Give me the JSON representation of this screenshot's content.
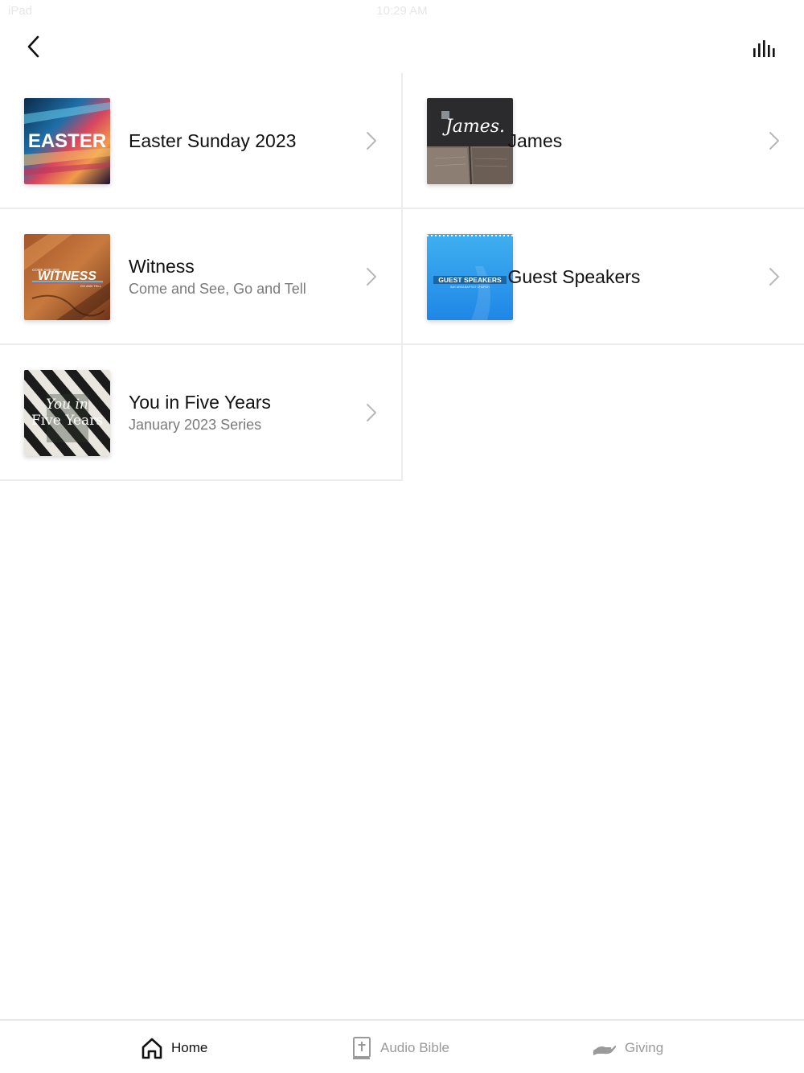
{
  "status_bar": {
    "carrier": "iPad",
    "time": "10:29 AM"
  },
  "nav": {
    "back_icon": "chevron-left-icon",
    "audio_icon": "audio-bars-icon"
  },
  "series": [
    {
      "title": "Easter Sunday 2023",
      "subtitle": "",
      "art_text": "EASTER"
    },
    {
      "title": "James",
      "subtitle": "",
      "art_text": "James."
    },
    {
      "title": "Witness",
      "subtitle": "Come and See, Go and Tell",
      "art_text": "WITNESS",
      "art_small_top": "COME AND SEE",
      "art_small_bottom": "GO AND TELL"
    },
    {
      "title": "Guest Speakers",
      "subtitle": "",
      "art_text": "GUEST SPEAKERS",
      "art_small": "BAY AREA BAPTIST CHURCH"
    },
    {
      "title": "You in Five Years",
      "subtitle": "January 2023 Series",
      "art_text_1": "You in",
      "art_text_2": "Five Years"
    }
  ],
  "tabs": [
    {
      "label": "Home",
      "icon": "home-icon",
      "active": true
    },
    {
      "label": "Audio Bible",
      "icon": "bible-icon",
      "active": false
    },
    {
      "label": "Giving",
      "icon": "giving-hand-icon",
      "active": false
    }
  ],
  "colors": {
    "divider": "#ececec",
    "active_tab": "#111111",
    "inactive_tab": "#9a9a9a",
    "subtitle": "#7a7a7a"
  }
}
